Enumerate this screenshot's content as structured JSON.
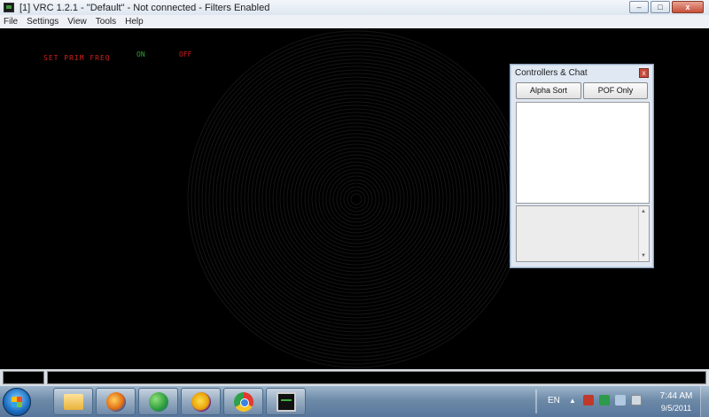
{
  "window": {
    "title": "[1] VRC 1.2.1 - \"Default\" - Not connected - Filters Enabled",
    "app_icon": "radar-scope-icon",
    "buttons": {
      "minimize": "–",
      "maximize": "□",
      "close": "x"
    }
  },
  "menu": {
    "items": [
      "File",
      "Settings",
      "View",
      "Tools",
      "Help"
    ]
  },
  "scope": {
    "prim_freq_label": "SET PRIM FREQ",
    "on_label": "ON",
    "off_label": "OFF",
    "colors": {
      "background": "#000000",
      "alert": "#d02020",
      "ok": "#2ea52e"
    }
  },
  "controllers_panel": {
    "title": "Controllers & Chat",
    "close": "x",
    "alpha_sort_label": "Alpha Sort",
    "pof_only_label": "POF Only",
    "controllers": [],
    "chat_lines": []
  },
  "command_bar": {
    "left_value": "",
    "input_value": ""
  },
  "taskbar": {
    "pinned_icons": [
      "folder-icon",
      "firefox-icon",
      "messenger-icon",
      "yahoo-messenger-icon",
      "chrome-icon",
      "vrc-icon"
    ],
    "language": "EN",
    "time": "7:44 AM",
    "date": "9/5/2011"
  }
}
